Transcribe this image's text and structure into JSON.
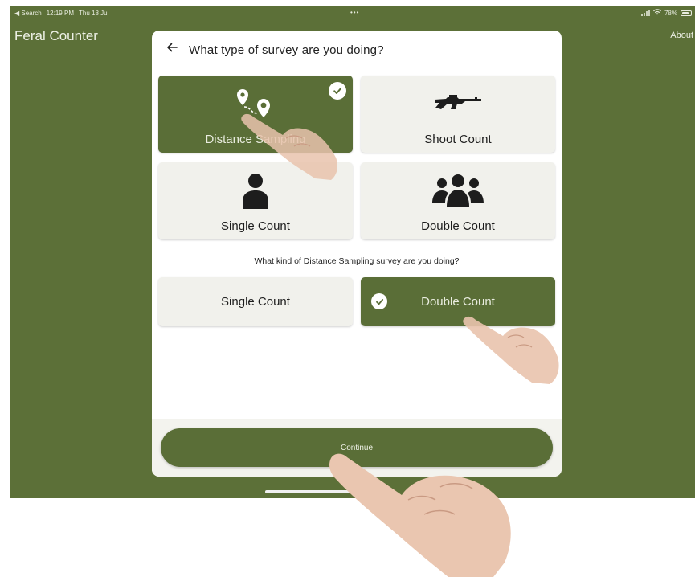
{
  "status_bar": {
    "back_label": "◀ Search",
    "time": "12:19 PM",
    "date": "Thu 18 Jul",
    "dots": "•••",
    "battery": "78%",
    "battery_level": 0.78
  },
  "app": {
    "title": "Feral Counter",
    "about": "About"
  },
  "modal": {
    "back_icon": "arrow-left-icon",
    "title": "What type of survey are you doing?",
    "survey_types": [
      {
        "label": "Distance Sampling",
        "icon": "route-pins-icon",
        "selected": true
      },
      {
        "label": "Shoot Count",
        "icon": "rifle-icon",
        "selected": false
      },
      {
        "label": "Single Count",
        "icon": "person-icon",
        "selected": false
      },
      {
        "label": "Double Count",
        "icon": "group-icon",
        "selected": false
      }
    ],
    "sub_question": "What kind of Distance Sampling survey are you doing?",
    "sub_options": [
      {
        "label": "Single Count",
        "selected": false
      },
      {
        "label": "Double Count",
        "selected": true
      }
    ],
    "continue_label": "Continue"
  },
  "colors": {
    "background_green": "#5c7038",
    "selected_green": "#5a6e37",
    "tile_bg": "#f1f1ec"
  }
}
